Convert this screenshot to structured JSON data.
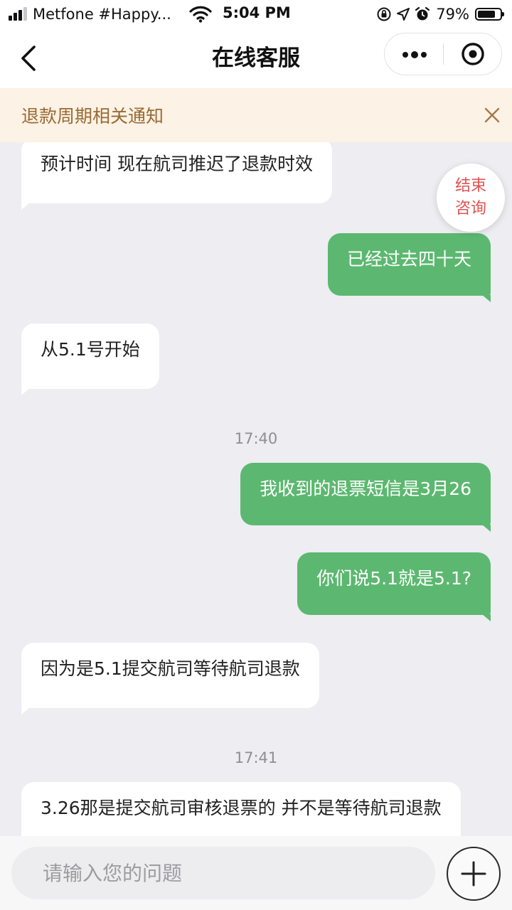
{
  "status_bar": {
    "carrier": "Metfone #Happy...",
    "time": "5:04 PM",
    "battery_percent": "79%",
    "battery_level": 0.79,
    "icons": [
      "signal-icon",
      "wifi-icon",
      "orientation-lock-icon",
      "location-arrow-icon",
      "alarm-icon",
      "battery-icon"
    ]
  },
  "nav": {
    "title": "在线客服",
    "icons": [
      "back-icon",
      "more-icon",
      "mini-program-close-icon"
    ]
  },
  "notice": {
    "text": "退款周期相关通知",
    "icon": "close-icon"
  },
  "end_button": {
    "line1": "结束",
    "line2": "咨询"
  },
  "messages": [
    {
      "side": "left",
      "text": "预计时间 现在航司推迟了退款时效"
    },
    {
      "side": "right",
      "text": "已经过去四十天"
    },
    {
      "side": "left",
      "text": "从5.1号开始"
    },
    {
      "side": "time",
      "text": "17:40"
    },
    {
      "side": "right",
      "text": "我收到的退票短信是3月26"
    },
    {
      "side": "right",
      "text": "你们说5.1就是5.1?"
    },
    {
      "side": "left",
      "text": "因为是5.1提交航司等待航司退款"
    },
    {
      "side": "time",
      "text": "17:41"
    },
    {
      "side": "left",
      "text": "3.26那是提交航司审核退票的 并不是等待航司退款"
    }
  ],
  "input": {
    "value": "",
    "placeholder": "请输入您的问题"
  },
  "colors": {
    "outgoing_bubble": "#5cb870",
    "incoming_bubble": "#ffffff",
    "chat_background": "#ededf2",
    "notice_background": "#fcf2e5",
    "notice_text": "#9a6a33",
    "end_button_text": "#e05353"
  }
}
